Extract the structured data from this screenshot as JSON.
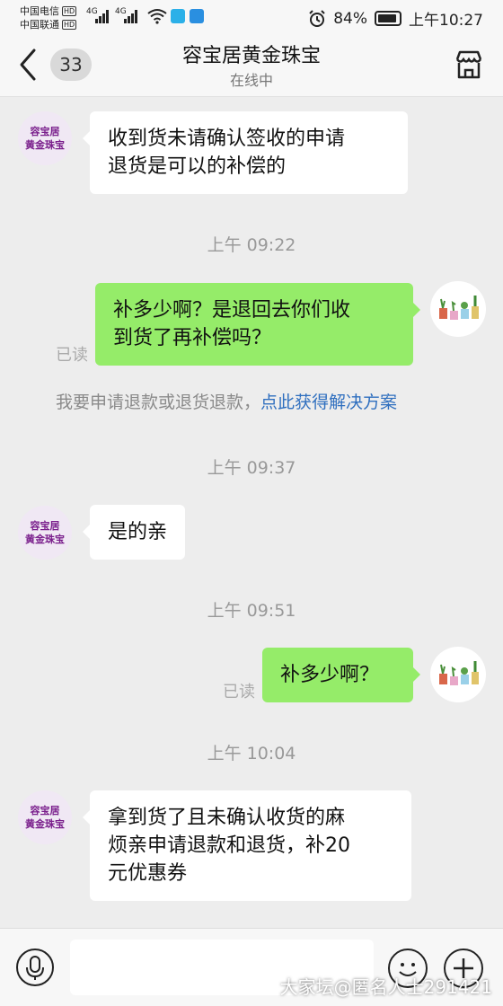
{
  "status_bar": {
    "carrier1": "中国电信",
    "carrier2": "中国联通",
    "hd": "HD",
    "net": "4G",
    "battery": "84%",
    "time": "上午10:27"
  },
  "header": {
    "unread_count": "33",
    "title": "容宝居黄金珠宝",
    "subtitle": "在线中"
  },
  "shop_avatar": {
    "line1": "容宝居",
    "line2": "黄金珠宝"
  },
  "messages": [
    {
      "text_lines": [
        "收到货未请确认签收的申请",
        "退货是可以的补偿的"
      ]
    },
    {
      "time": "上午 09:22"
    },
    {
      "text_lines": [
        "补多少啊？是退回去你们收",
        "到货了再补偿吗？"
      ],
      "status": "已读"
    },
    {
      "notice": "我要申请退款或退货退款，",
      "link": "点此获得解决方案"
    },
    {
      "time": "上午 09:37"
    },
    {
      "text": "是的亲"
    },
    {
      "time": "上午 09:51"
    },
    {
      "text": "补多少啊？",
      "status": "已读"
    },
    {
      "time": "上午 10:04"
    },
    {
      "text_lines": [
        "拿到货了且未确认收货的麻",
        "烦亲申请退款和退货，补20",
        "元优惠券"
      ]
    }
  ],
  "watermark": "大家坛@匿名人士291421",
  "colors": {
    "my_bubble": "#95ec69",
    "their_bubble": "#ffffff",
    "background": "#ededed",
    "link": "#2f6fbf"
  }
}
